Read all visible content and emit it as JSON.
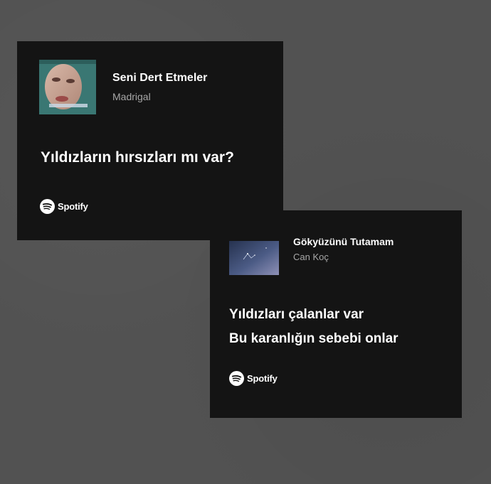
{
  "cards": [
    {
      "title": "Seni Dert Etmeler",
      "artist": "Madrigal",
      "lyrics": [
        "Yıldızların hırsızları mı var?"
      ],
      "brand": "Spotify",
      "icons": {
        "art": "album-art-portrait",
        "logo": "spotify-logo-icon"
      }
    },
    {
      "title": "Gökyüzünü Tutamam",
      "artist": "Can Koç",
      "lyrics": [
        "Yıldızları çalanlar var",
        "Bu karanlığın sebebi onlar"
      ],
      "brand": "Spotify",
      "icons": {
        "art": "album-art-sky",
        "logo": "spotify-logo-icon"
      }
    }
  ],
  "colors": {
    "background": "#525252",
    "card": "#141414",
    "text_primary": "#ffffff",
    "text_secondary": "#a7a7a7"
  }
}
